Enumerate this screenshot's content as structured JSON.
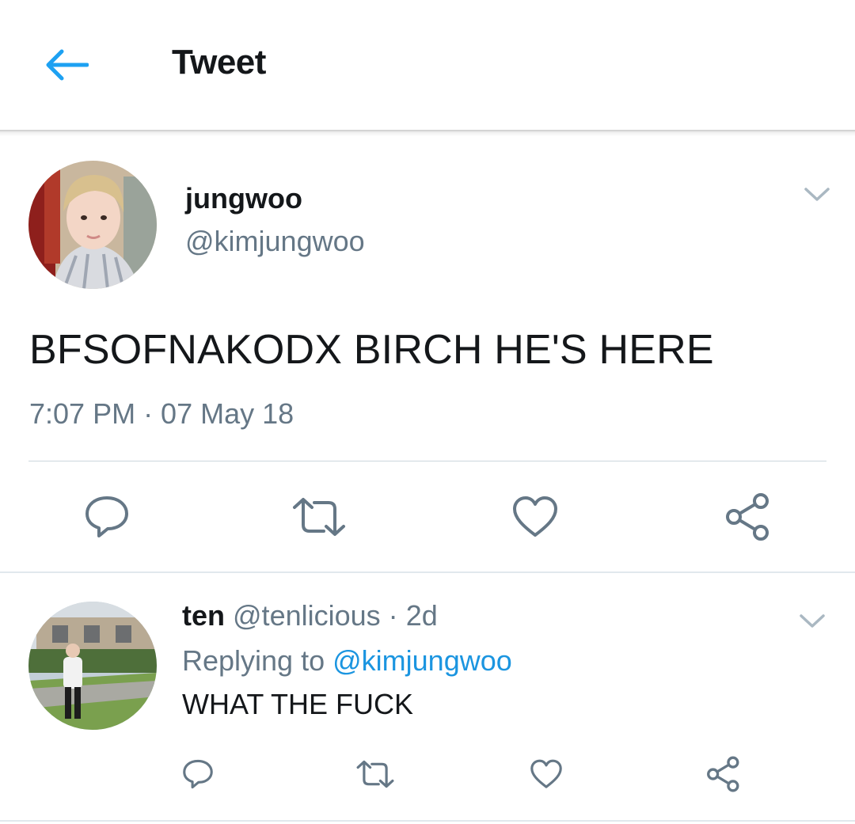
{
  "header": {
    "title": "Tweet",
    "back_icon": "arrow-left-icon",
    "accent_color": "#1da1f2"
  },
  "tweet": {
    "author_name": "jungwoo",
    "author_handle": "@kimjungwoo",
    "text": "BFSOFNAKODX BIRCH HE'S HERE",
    "timestamp": "7:07 PM · 07 May 18",
    "actions": [
      "reply-icon",
      "retweet-icon",
      "like-icon",
      "share-icon"
    ]
  },
  "reply": {
    "author_name": "ten",
    "author_handle": "@tenlicious",
    "age": "2d",
    "replying_to_label": "Replying to",
    "replying_to_handle": "@kimjungwoo",
    "text": "WHAT THE FUCK",
    "actions": [
      "reply-icon",
      "retweet-icon",
      "like-icon",
      "share-icon"
    ]
  },
  "colors": {
    "text_primary": "#14171a",
    "text_secondary": "#657786",
    "link": "#1b95e0",
    "divider": "#ccd6dd"
  }
}
